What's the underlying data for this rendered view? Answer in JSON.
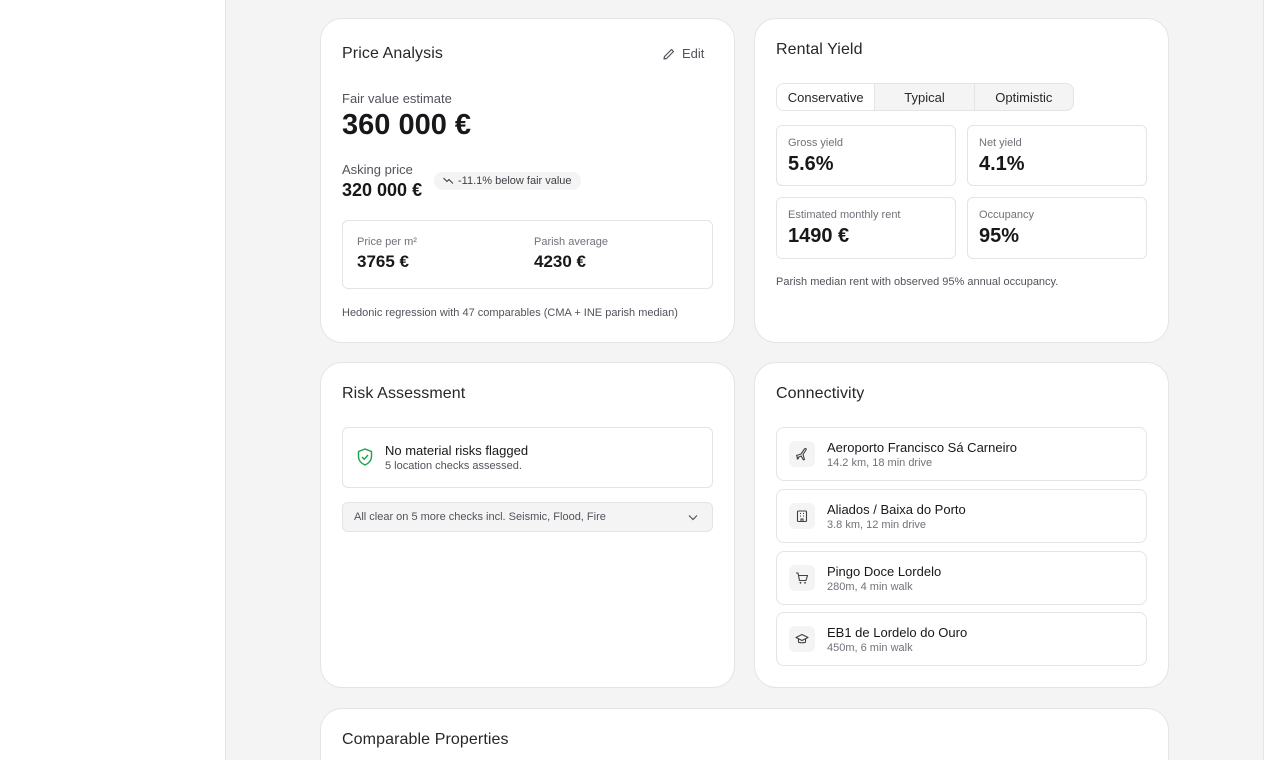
{
  "price_analysis": {
    "title": "Price Analysis",
    "edit_label": "Edit",
    "fair_value_label": "Fair value estimate",
    "fair_value": "360 000 €",
    "asking_label": "Asking price",
    "asking_value": "320 000 €",
    "delta_badge": "-11.1% below fair value",
    "price_per_m2_label": "Price per m²",
    "price_per_m2_value": "3765 €",
    "parish_avg_label": "Parish average",
    "parish_avg_value": "4230 €",
    "footnote": "Hedonic regression with 47 comparables (CMA + INE parish median)"
  },
  "rental_yield": {
    "title": "Rental Yield",
    "scenarios": [
      "Conservative",
      "Typical",
      "Optimistic"
    ],
    "active_scenario": "Conservative",
    "gross_label": "Gross yield",
    "gross_value": "5.6%",
    "net_label": "Net yield",
    "net_value": "4.1%",
    "rent_label": "Estimated monthly rent",
    "rent_value": "1490 €",
    "occupancy_label": "Occupancy",
    "occupancy_value": "95%",
    "footnote": "Parish median rent with observed 95% annual occupancy."
  },
  "risk": {
    "title": "Risk Assessment",
    "status_title": "No material risks flagged",
    "status_detail": "5 location checks assessed.",
    "expand_label": "All clear on 5 more checks incl. Seismic, Flood, Fire"
  },
  "connectivity": {
    "title": "Connectivity",
    "items": [
      {
        "name": "Aeroporto Francisco Sá Carneiro",
        "meta": "14.2 km, 18 min drive",
        "icon": "plane-icon"
      },
      {
        "name": "Aliados / Baixa do Porto",
        "meta": "3.8 km, 12 min drive",
        "icon": "building-icon"
      },
      {
        "name": "Pingo Doce Lordelo",
        "meta": "280m, 4 min walk",
        "icon": "cart-icon"
      },
      {
        "name": "EB1 de Lordelo do Ouro",
        "meta": "450m, 6 min walk",
        "icon": "school-icon"
      }
    ]
  },
  "comparables": {
    "title": "Comparable Properties"
  },
  "colors": {
    "accent_green": "#16a34a",
    "border": "#e4e4e7",
    "muted": "#71717a"
  }
}
